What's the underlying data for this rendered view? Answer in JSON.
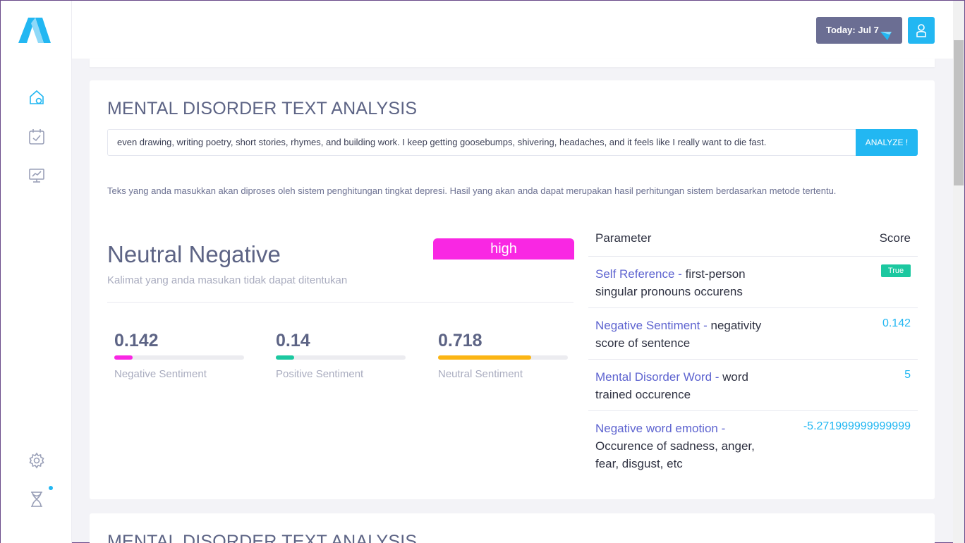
{
  "header": {
    "today_label": "Today: Jul 7"
  },
  "sidebar": {
    "items": [
      {
        "icon": "home-icon"
      },
      {
        "icon": "calendar-check-icon"
      },
      {
        "icon": "presentation-chart-icon"
      },
      {
        "icon": "gear-icon"
      },
      {
        "icon": "hourglass-icon"
      }
    ]
  },
  "main": {
    "title": "MENTAL DISORDER TEXT ANALYSIS",
    "input_value": "even drawing, writing poetry, short stories, rhymes, and building work. I keep getting goosebumps, shivering, headaches, and it feels like I really want to die fast.",
    "analyze_label": "ANALYZE !",
    "description": "Teks yang anda masukkan akan diproses oleh sistem penghitungan tingkat depresi. Hasil yang akan anda dapat merupakan hasil perhitungan sistem berdasarkan metode tertentu.",
    "result": {
      "title": "Neutral Negative",
      "subtitle": "Kalimat yang anda masukan tidak dapat ditentukan",
      "level": "high"
    },
    "metrics": [
      {
        "value": "0.142",
        "label": "Negative Sentiment",
        "fraction": 0.142,
        "color": "#f927e3"
      },
      {
        "value": "0.14",
        "label": "Positive Sentiment",
        "fraction": 0.14,
        "color": "#1cc8a0"
      },
      {
        "value": "0.718",
        "label": "Neutral Sentiment",
        "fraction": 0.718,
        "color": "#fbb514"
      }
    ],
    "parameters": {
      "header_parameter": "Parameter",
      "header_score": "Score",
      "rows": [
        {
          "name": "Self Reference -",
          "desc": "first-person singular pronouns occurens",
          "score": "True"
        },
        {
          "name": "Negative Sentiment -",
          "desc": "negativity score of sentence",
          "score": "0.142"
        },
        {
          "name": "Mental Disorder Word -",
          "desc": "word trained occurence",
          "score": "5"
        },
        {
          "name": "Negative word emotion -",
          "desc": "Occurence of sadness, anger, fear, disgust, etc",
          "score": "-5.271999999999999"
        }
      ]
    }
  },
  "second_card": {
    "title": "MENTAL DISORDER TEXT ANALYSIS"
  },
  "colors": {
    "accent": "#22b7f2",
    "text_primary": "#5d6485",
    "badge_high": "#f927e3",
    "badge_true": "#1cc8a0"
  }
}
